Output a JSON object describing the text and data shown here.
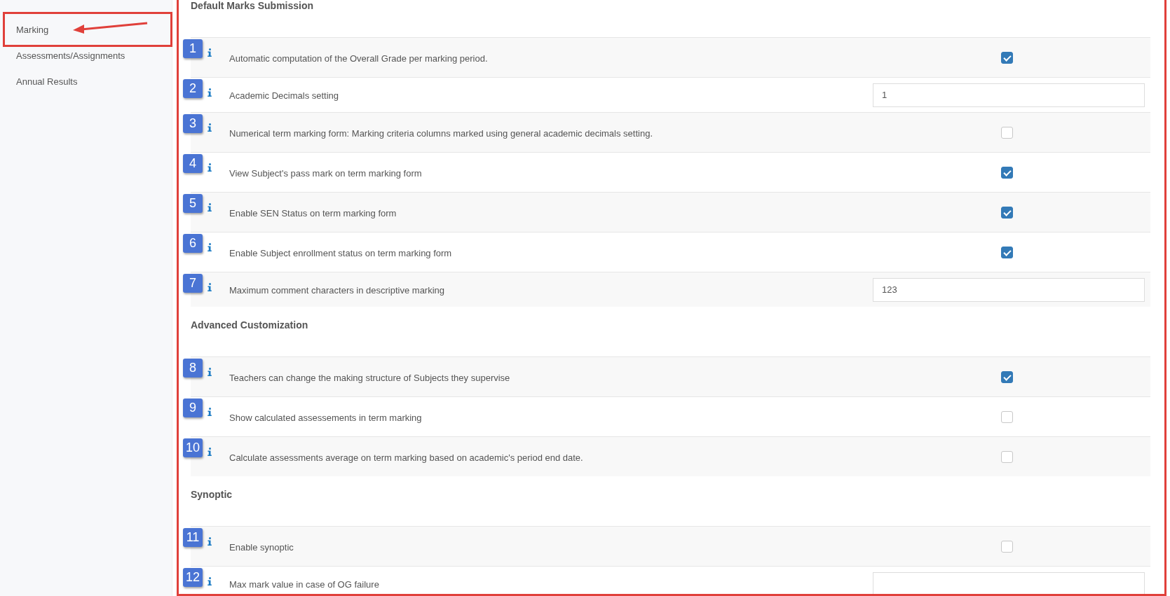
{
  "sidebar": {
    "items": [
      {
        "label": "Marking",
        "highlighted": true
      },
      {
        "label": "Assessments/Assignments",
        "highlighted": false
      },
      {
        "label": "Annual Results",
        "highlighted": false
      }
    ]
  },
  "sections": [
    {
      "title": "Default Marks Submission",
      "rows": [
        {
          "badge": "1",
          "label": "Automatic computation of the Overall Grade per marking period.",
          "kind": "checkbox",
          "checked": true
        },
        {
          "badge": "2",
          "label": "Academic Decimals setting",
          "kind": "input",
          "value": "1"
        },
        {
          "badge": "3",
          "label": "Numerical term marking form: Marking criteria columns marked using general academic decimals setting.",
          "kind": "checkbox",
          "checked": false
        },
        {
          "badge": "4",
          "label": "View Subject's pass mark on term marking form",
          "kind": "checkbox",
          "checked": true
        },
        {
          "badge": "5",
          "label": "Enable SEN Status on term marking form",
          "kind": "checkbox",
          "checked": true
        },
        {
          "badge": "6",
          "label": "Enable Subject enrollment status on term marking form",
          "kind": "checkbox",
          "checked": true
        },
        {
          "badge": "7",
          "label": "Maximum comment characters in descriptive marking",
          "kind": "input",
          "value": "123"
        }
      ]
    },
    {
      "title": "Advanced Customization",
      "rows": [
        {
          "badge": "8",
          "label": "Teachers can change the making structure of Subjects they supervise",
          "kind": "checkbox",
          "checked": true
        },
        {
          "badge": "9",
          "label": "Show calculated assessements in term marking",
          "kind": "checkbox",
          "checked": false
        },
        {
          "badge": "10",
          "label": "Calculate assessments average on term marking based on academic's period end date.",
          "kind": "checkbox",
          "checked": false
        }
      ]
    },
    {
      "title": "Synoptic",
      "rows": [
        {
          "badge": "11",
          "label": "Enable synoptic",
          "kind": "checkbox",
          "checked": false
        },
        {
          "badge": "12",
          "label": "Max mark value in case of OG failure",
          "kind": "input"
        }
      ]
    }
  ]
}
